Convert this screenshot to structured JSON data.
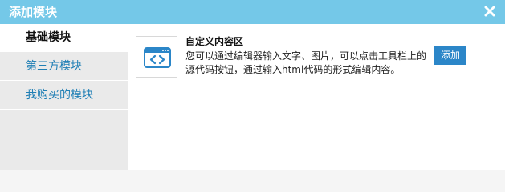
{
  "dialog": {
    "title": "添加模块",
    "colors": {
      "titlebar": "#74c8e8",
      "sidebar": "#eaeaea",
      "link": "#1f7fb5",
      "button": "#2b86c8"
    },
    "icons": {
      "close": "close-icon",
      "module": "code-window-icon"
    }
  },
  "sidebar": {
    "items": [
      {
        "label": "基础模块",
        "active": true
      },
      {
        "label": "第三方模块",
        "active": false
      },
      {
        "label": "我购买的模块",
        "active": false
      }
    ]
  },
  "module": {
    "title": "自定义内容区",
    "description": "您可以通过编辑器输入文字、图片，可以点击工具栏上的源代码按钮，通过输入html代码的形式编辑内容。",
    "add_label": "添加"
  }
}
